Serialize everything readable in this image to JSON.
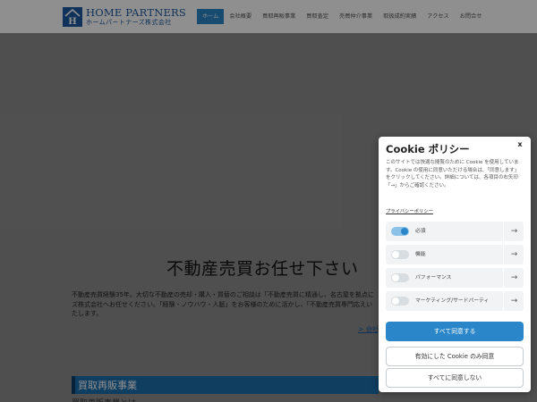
{
  "header": {
    "logo": {
      "name_en": "HOME PARTNERS",
      "name_ja": "ホームパートナーズ株式会社"
    },
    "nav": [
      {
        "label": "ホーム",
        "active": true
      },
      {
        "label": "会社概要",
        "active": false
      },
      {
        "label": "買取再販事業",
        "active": false
      },
      {
        "label": "買取査定",
        "active": false
      },
      {
        "label": "売買仲介事業",
        "active": false
      },
      {
        "label": "取扱成約実績",
        "active": false
      },
      {
        "label": "アクセス",
        "active": false
      },
      {
        "label": "お問合せ",
        "active": false
      }
    ]
  },
  "main": {
    "heading": "不動産売買お任せ下さい",
    "body": "不動産売買経験35年。大切な不動産の売却・購入・買替のご相談は「不動産売買に精通し、名古屋を拠点にズ株式会社へお任せください。「経験・ノウハウ・人脈」をお客様のために活かし、「不動産売買専門応えいたします。",
    "more_link": "> 会社",
    "section_title": "買取再販事業",
    "sub_heading": "買取再販事業とは"
  },
  "cookie_dialog": {
    "title": "Cookie ポリシー",
    "close": "x",
    "description": "このサイトでは快適な閲覧のために Cookie を使用しています。Cookie の使用に同意いただける場合は、「同意します」をクリックしてください。詳細については、各項目の右矢印「→」からご確認ください。",
    "privacy_link": "プライバシーポリシー",
    "categories": [
      {
        "label": "必須",
        "enabled": true
      },
      {
        "label": "機能",
        "enabled": false
      },
      {
        "label": "パフォーマンス",
        "enabled": false
      },
      {
        "label": "マーケティング/サードパーティ",
        "enabled": false
      }
    ],
    "arrow": "→",
    "buttons": {
      "accept_all": "すべて同意する",
      "accept_selected": "有効にした Cookie のみ同意",
      "reject_all": "すべてに同意しない"
    }
  },
  "colors": {
    "accent": "#2a86c8",
    "brand": "#1e5aa0",
    "section_bar": "#1e6fae"
  }
}
